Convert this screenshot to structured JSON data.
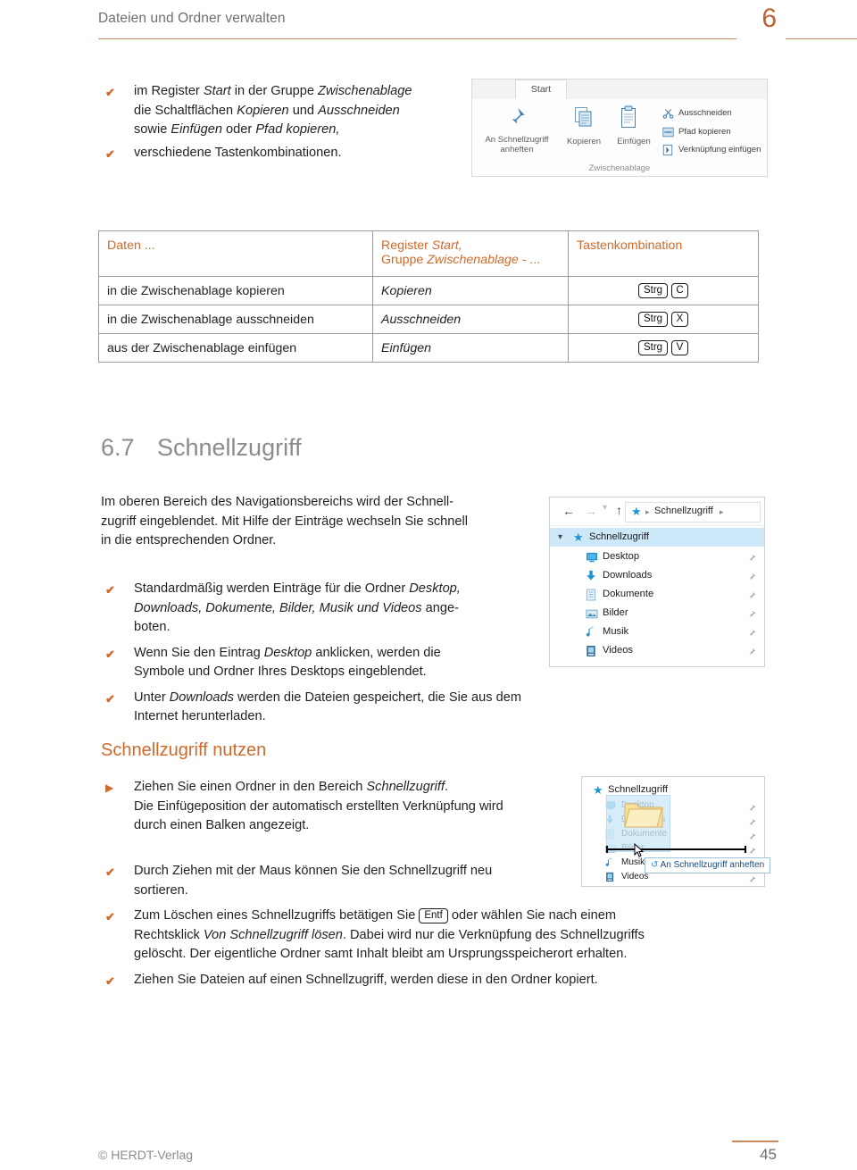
{
  "header": {
    "title": "Dateien und Ordner verwalten",
    "chapter_number": "6"
  },
  "intro_bullets": [
    {
      "lines": [
        [
          {
            "t": "im Register "
          },
          {
            "t": "Start",
            "i": true
          },
          {
            "t": " in der Gruppe "
          },
          {
            "t": "Zwischenablage",
            "i": true
          }
        ],
        [
          {
            "t": "die Schaltflächen "
          },
          {
            "t": "Kopieren",
            "i": true
          },
          {
            "t": " und "
          },
          {
            "t": "Ausschneiden",
            "i": true
          }
        ],
        [
          {
            "t": "sowie "
          },
          {
            "t": "Einfügen",
            "i": true
          },
          {
            "t": " oder "
          },
          {
            "t": "Pfad kopieren,",
            "i": true
          }
        ]
      ]
    },
    {
      "lines": [
        [
          {
            "t": "verschiedene Tastenkombinationen."
          }
        ]
      ]
    }
  ],
  "ribbon": {
    "tab_label": "Start",
    "group_label": "Zwischenablage",
    "pin_button_line1": "An Schnellzugriff",
    "pin_button_line2": "anheften",
    "copy_label": "Kopieren",
    "paste_label": "Einfügen",
    "cut_label": "Ausschneiden",
    "copy_path_label": "Pfad kopieren",
    "paste_shortcut_label": "Verknüpfung einfügen"
  },
  "table": {
    "headers": {
      "col1": "Daten ...",
      "col2_line1_pre": "Register ",
      "col2_line1_em": "Start,",
      "col2_line2_pre": "Gruppe ",
      "col2_line2_em": "Zwischenablage",
      "col2_line2_post": " - ...",
      "col3": "Tastenkombination"
    },
    "rows": [
      {
        "action": "in die Zwischenablage kopieren",
        "command": "Kopieren",
        "keys": [
          "Strg",
          "C"
        ]
      },
      {
        "action": "in die Zwischenablage ausschneiden",
        "command": "Ausschneiden",
        "keys": [
          "Strg",
          "X"
        ]
      },
      {
        "action": "aus der Zwischenablage einfügen",
        "command": "Einfügen",
        "keys": [
          "Strg",
          "V"
        ]
      }
    ]
  },
  "section": {
    "number": "6.7",
    "title": "Schnellzugriff",
    "paragraph_lines": [
      "Im oberen Bereich des Navigationsbereichs wird der Schnell-",
      "zugriff eingeblendet. Mit Hilfe der Einträge wechseln Sie schnell",
      "in die entsprechenden Ordner."
    ]
  },
  "section_bullets": [
    {
      "lines": [
        [
          {
            "t": "Standardmäßig werden Einträge für die Ordner "
          },
          {
            "t": "Desktop,",
            "i": true
          }
        ],
        [
          {
            "t": "Downloads, Dokumente, Bilder, Musik und Videos",
            "i": true
          },
          {
            "t": " ange-"
          }
        ],
        [
          {
            "t": "boten."
          }
        ]
      ]
    },
    {
      "lines": [
        [
          {
            "t": "Wenn Sie den Eintrag "
          },
          {
            "t": "Desktop",
            "i": true
          },
          {
            "t": " anklicken, werden die"
          }
        ],
        [
          {
            "t": "Symbole und Ordner Ihres Desktops eingeblendet."
          }
        ]
      ]
    },
    {
      "lines": [
        [
          {
            "t": "Unter "
          },
          {
            "t": "Downloads",
            "i": true
          },
          {
            "t": " werden die Dateien gespeichert, die Sie aus dem Internet herunterladen."
          }
        ]
      ]
    }
  ],
  "explorer_panel_1": {
    "breadcrumb": "Schnellzugriff",
    "root_label": "Schnellzugriff",
    "items": [
      {
        "label": "Desktop",
        "icon": "monitor-icon"
      },
      {
        "label": "Downloads",
        "icon": "download-arrow-icon"
      },
      {
        "label": "Dokumente",
        "icon": "document-icon"
      },
      {
        "label": "Bilder",
        "icon": "picture-icon"
      },
      {
        "label": "Musik",
        "icon": "music-note-icon"
      },
      {
        "label": "Videos",
        "icon": "video-icon"
      }
    ]
  },
  "subsection": {
    "title": "Schnellzugriff nutzen",
    "step_line": [
      {
        "t": "Ziehen Sie einen Ordner in den Bereich "
      },
      {
        "t": "Schnellzugriff",
        "i": true
      },
      {
        "t": "."
      }
    ],
    "step_detail_lines": [
      "Die Einfügeposition der automatisch erstellten Verknüpfung wird",
      "durch einen Balken angezeigt."
    ]
  },
  "explorer_panel_2": {
    "root_label": "Schnellzugriff",
    "items": [
      {
        "label": "Desktop"
      },
      {
        "label": "Downloads"
      },
      {
        "label": "Dokumente"
      },
      {
        "label": "Bilder"
      },
      {
        "label": "Musik"
      },
      {
        "label": "Videos"
      }
    ],
    "tooltip": "An Schnellzugriff anheften"
  },
  "final_bullets": [
    {
      "lines": [
        [
          {
            "t": "Durch Ziehen mit der Maus können Sie den Schnellzugriff neu"
          }
        ],
        [
          {
            "t": "sortieren."
          }
        ]
      ]
    },
    {
      "lines": [
        [
          {
            "t": "Zum Löschen eines Schnellzugriffs betätigen Sie "
          },
          {
            "key": "Entf"
          },
          {
            "t": " oder wählen Sie nach einem"
          }
        ],
        [
          {
            "t": "Rechtsklick "
          },
          {
            "t": "Von Schnellzugriff lösen",
            "i": true
          },
          {
            "t": ". Dabei wird nur die Verknüpfung des Schnellzugriffs"
          }
        ],
        [
          {
            "t": "gelöscht. Der eigentliche Ordner samt Inhalt bleibt am Ursprungsspeicherort erhalten."
          }
        ]
      ]
    },
    {
      "lines": [
        [
          {
            "t": "Ziehen Sie Dateien auf einen Schnellzugriff, werden diese in den Ordner kopiert."
          }
        ]
      ]
    }
  ],
  "footer": {
    "copyright": "© HERDT-Verlag",
    "page_number": "45"
  },
  "colors": {
    "accent_orange": "#cf6a2c",
    "rule_orange": "#c98a5e",
    "heading_gray": "#8c8c8c",
    "explorer_blue": "#1d93d2",
    "selection_blue": "#cde8f9"
  }
}
